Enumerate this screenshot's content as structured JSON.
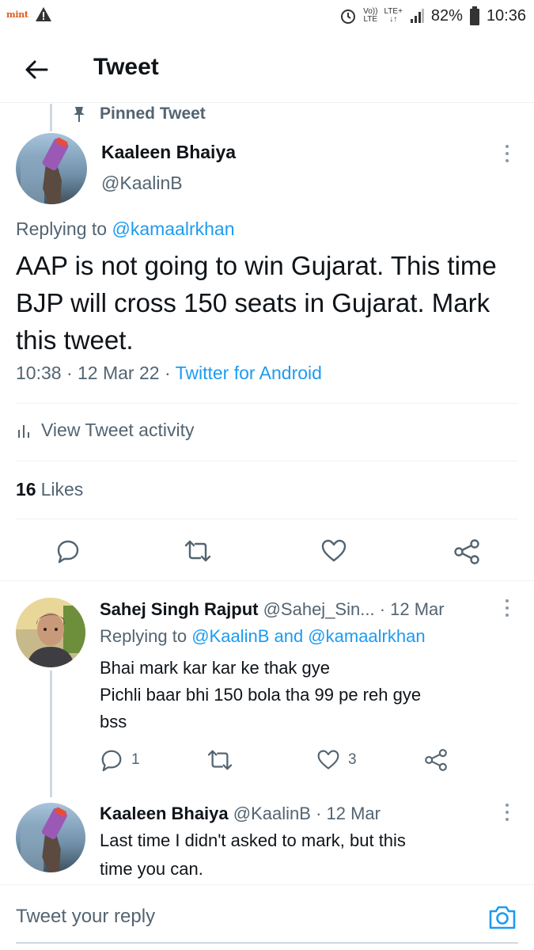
{
  "status_bar": {
    "app_logo": "mint",
    "warning_icon": "warning-icon",
    "network_top": "Vo))",
    "network_bottom": "LTE",
    "lte_plus": "LTE+",
    "battery": "82%",
    "time": "10:36"
  },
  "header": {
    "title": "Tweet"
  },
  "pinned_label": "Pinned Tweet",
  "main_tweet": {
    "name": "Kaaleen Bhaiya",
    "handle": "@KaalinB",
    "replying_prefix": "Replying to",
    "replying_to": "@kamaalrkhan",
    "text": "AAP is not going to win Gujarat. This time BJP will cross 150 seats in Gujarat. Mark this tweet.",
    "time": "10:38 · 12 Mar 22 ·",
    "source": "Twitter for Android",
    "activity": "View Tweet activity",
    "likes_count": "16",
    "likes_label": "Likes"
  },
  "reply1": {
    "name": "Sahej Singh Rajput",
    "handle": "@Sahej_Sin...",
    "date": "· 12 Mar",
    "replying_prefix": "Replying to",
    "replying_to": "@KaalinB and @kamaalrkhan",
    "line1": "Bhai mark kar kar ke thak gye",
    "line2": "Pichli baar bhi 150 bola tha 99 pe reh gye",
    "line3": "bss",
    "reply_count": "1",
    "like_count": "3"
  },
  "reply2": {
    "name": "Kaaleen Bhaiya",
    "handle": "@KaalinB",
    "date": "· 12 Mar",
    "line1": "Last time I didn't asked to mark, but this",
    "line2": "time you can."
  },
  "compose": {
    "placeholder": "Tweet your reply"
  },
  "colors": {
    "accent": "#1d9bf0",
    "text": "#0f1419",
    "secondary": "#536471"
  }
}
